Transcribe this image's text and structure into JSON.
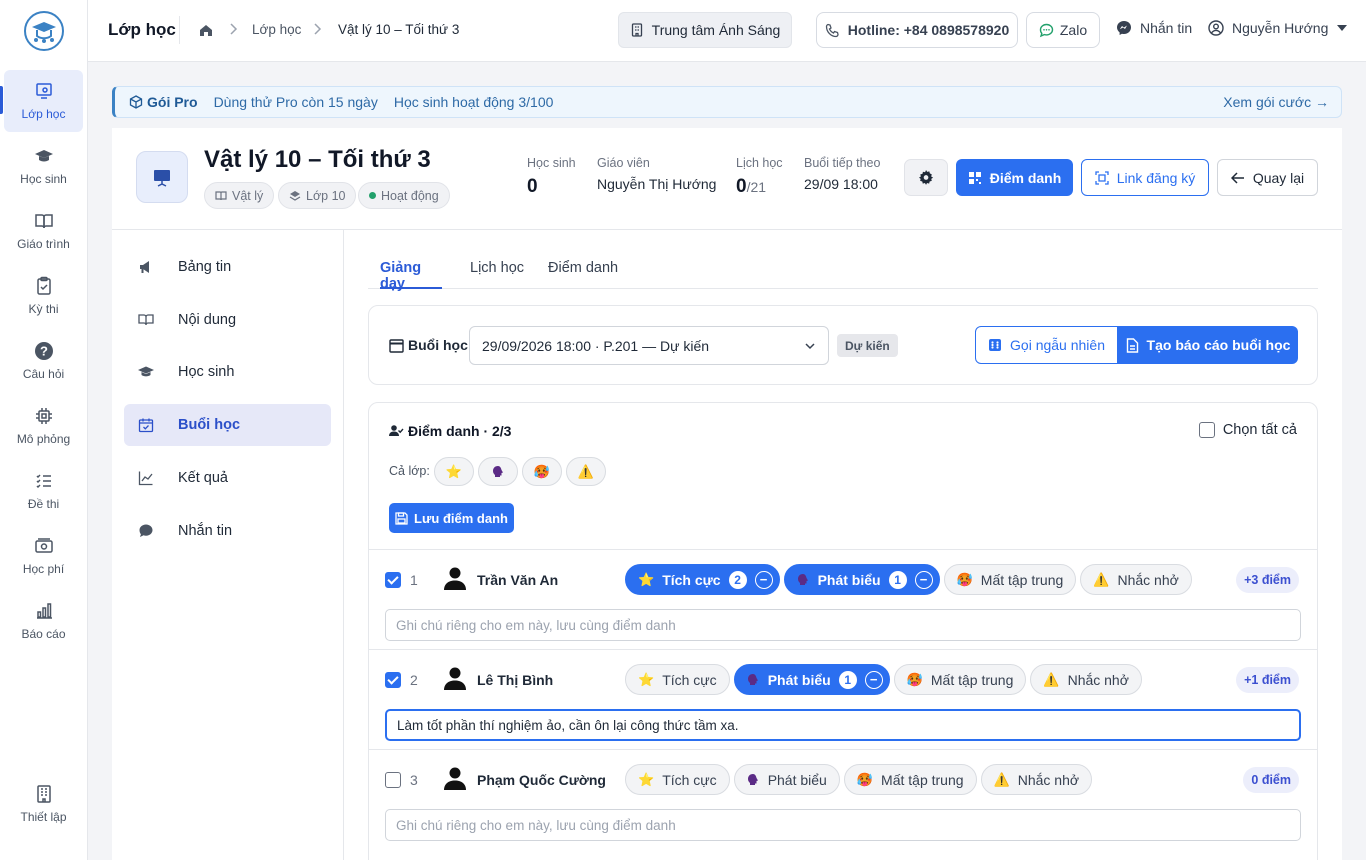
{
  "rail": {
    "items": [
      {
        "label": "Lớp học",
        "icon": "classroom-icon"
      },
      {
        "label": "Học sinh",
        "icon": "graduation-cap-icon"
      },
      {
        "label": "Giáo trình",
        "icon": "book-icon"
      },
      {
        "label": "Kỳ thi",
        "icon": "clipboard-check-icon"
      },
      {
        "label": "Câu hỏi",
        "icon": "question-icon"
      },
      {
        "label": "Mô phỏng",
        "icon": "chip-icon"
      },
      {
        "label": "Đề thi",
        "icon": "list-icon"
      },
      {
        "label": "Học phí",
        "icon": "money-icon"
      },
      {
        "label": "Báo cáo",
        "icon": "bar-chart-icon"
      }
    ],
    "settings": "Thiết lập"
  },
  "topbar": {
    "title": "Lớp học",
    "crumbs": [
      "Lớp học",
      "Vật lý 10 – Tối thứ 3"
    ],
    "center": "Trung tâm Ánh Sáng",
    "hotline": "Hotline: +84 0898578920",
    "zalo": "Zalo",
    "message": "Nhắn tin",
    "user": "Nguyễn Hướng"
  },
  "banner": {
    "pro": "Gói Pro",
    "trial": "Dùng thử Pro còn 15 ngày",
    "students": "Học sinh hoạt động 3/100",
    "link": "Xem gói cước →"
  },
  "classinfo": {
    "title": "Vật lý 10 – Tối thứ 3",
    "tags": [
      "Vật lý",
      "Lớp 10",
      "Hoạt động"
    ],
    "stats": {
      "students_label": "Học sinh",
      "students": "0",
      "teacher_label": "Giáo viên",
      "teacher": "Nguyễn Thị Hướng",
      "schedule_label": "Lịch học",
      "schedule": "0",
      "schedule_total": "/21",
      "next_label": "Buổi tiếp theo",
      "next": "29/09 18:00"
    },
    "attendance_btn": "Điểm danh",
    "link_btn": "Link đăng ký",
    "back_btn": "Quay lại"
  },
  "innernav": [
    "Bảng tin",
    "Nội dung",
    "Học sinh",
    "Buổi học",
    "Kết quả",
    "Nhắn tin"
  ],
  "tabs": [
    "Giảng dạy",
    "Lịch học",
    "Điểm danh"
  ],
  "session": {
    "label": "Buổi học",
    "value": "29/09/2026 18:00 · P.201 — Dự kiến",
    "badge": "Dự kiến",
    "random_btn": "Gọi ngẫu nhiên",
    "report_btn": "Tạo báo cáo buổi học"
  },
  "attendance": {
    "title": "Điểm danh · 2/3",
    "select_all": "Chọn tất cả",
    "class_label": "Cả lớp:",
    "save_btn": "Lưu điểm danh",
    "chip_labels": [
      "Tích cực",
      "Phát biểu",
      "Mất tập trung",
      "Nhắc nhở"
    ],
    "note_placeholder": "Ghi chú riêng cho em này, lưu cùng điểm danh",
    "students": [
      {
        "num": "1",
        "name": "Trần Văn An",
        "checked": true,
        "counts": [
          2,
          1,
          0,
          0
        ],
        "points": "+3 điểm",
        "note": ""
      },
      {
        "num": "2",
        "name": "Lê Thị Bình",
        "checked": true,
        "counts": [
          0,
          1,
          0,
          0
        ],
        "points": "+1 điểm",
        "note": "Làm tốt phần thí nghiệm ảo, cần ôn lại công thức tầm xa."
      },
      {
        "num": "3",
        "name": "Phạm Quốc Cường",
        "checked": false,
        "counts": [
          0,
          0,
          0,
          0
        ],
        "points": "0 điểm",
        "note": ""
      }
    ]
  },
  "colors": {
    "primary": "#2b6ff0",
    "accent": "#2b5bd7",
    "banner": "#eef6fd"
  }
}
